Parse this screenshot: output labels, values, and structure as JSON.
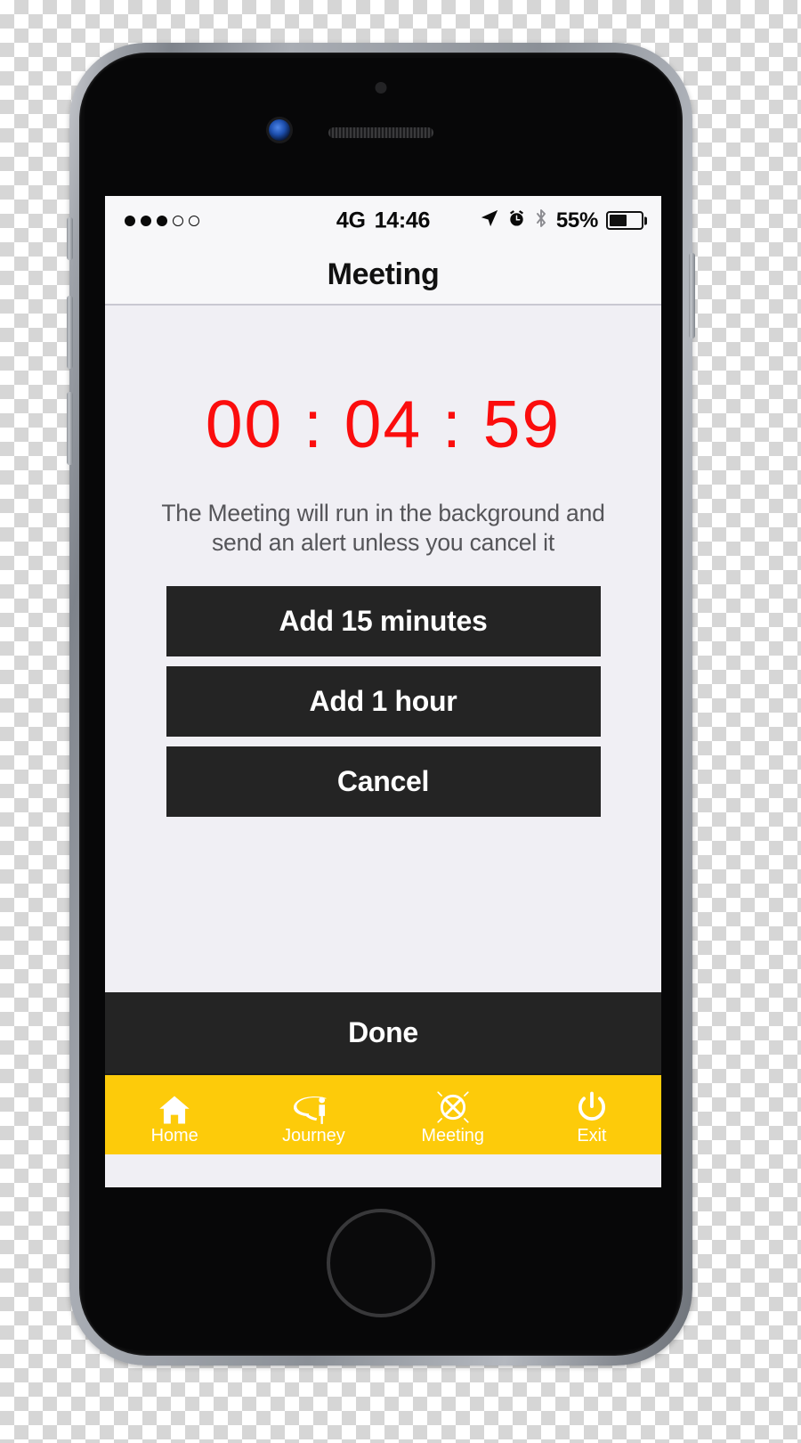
{
  "device": {
    "name": "iphone-mockup",
    "frame_color": "#9fa3aa",
    "body_color": "#0b0b0c"
  },
  "screen": {
    "background": "#f0eff4",
    "status_bar": {
      "signal_dots_total": 5,
      "signal_dots_filled": 3,
      "carrier_network": "4G",
      "time": "14:46",
      "battery_percent": "55%",
      "battery_level": 55,
      "icons": [
        "location-arrow-icon",
        "alarm-clock-icon",
        "bluetooth-icon"
      ]
    },
    "navbar": {
      "title": "Meeting"
    },
    "main": {
      "timer": "00 : 04 : 59",
      "timer_color": "#fb0d0d",
      "description": "The Meeting will run in the background and send an alert unless you cancel it",
      "buttons": [
        {
          "label": "Add 15 minutes",
          "name": "add-15-minutes-button"
        },
        {
          "label": "Add 1 hour",
          "name": "add-1-hour-button"
        },
        {
          "label": "Cancel",
          "name": "cancel-button"
        }
      ],
      "button_bg": "#242424",
      "button_text_color": "#ffffff"
    },
    "done_bar": {
      "label": "Done",
      "background": "#242424"
    },
    "tabbar": {
      "background": "#fdcb0a",
      "text_color": "#ffffff",
      "tabs": [
        {
          "label": "Home",
          "icon": "home-icon",
          "active": false
        },
        {
          "label": "Journey",
          "icon": "journey-icon",
          "active": false
        },
        {
          "label": "Meeting",
          "icon": "meeting-cross-circle-icon",
          "active": true
        },
        {
          "label": "Exit",
          "icon": "power-icon",
          "active": false
        }
      ]
    }
  }
}
